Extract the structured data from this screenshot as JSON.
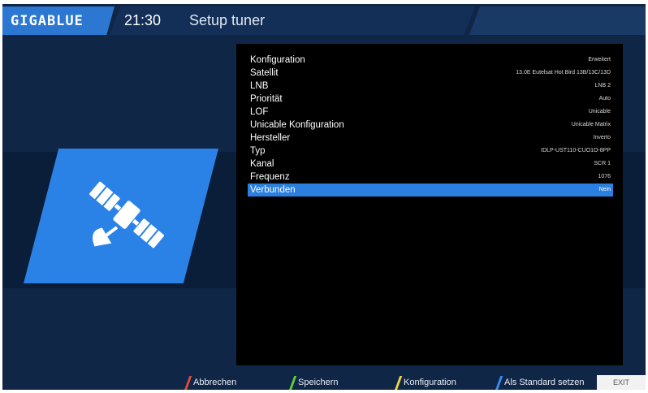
{
  "header": {
    "logo": "GIGABLUE",
    "time": "21:30",
    "title": "Setup tuner"
  },
  "icon": {
    "name": "satellite-icon"
  },
  "settings": [
    {
      "label": "Konfiguration",
      "value": "Erweitert"
    },
    {
      "label": "Satellit",
      "value": "13.0E Eutelsat Hot Bird 13B/13C/13D"
    },
    {
      "label": "LNB",
      "value": "LNB 2"
    },
    {
      "label": "Priorität",
      "value": "Auto"
    },
    {
      "label": "LOF",
      "value": "Unicable"
    },
    {
      "label": "Unicable Konfiguration",
      "value": "Unicable Matrix"
    },
    {
      "label": "Hersteller",
      "value": "Inverto"
    },
    {
      "label": "Typ",
      "value": "IDLP-UST110-CUO1O-8PP"
    },
    {
      "label": "Kanal",
      "value": "SCR 1"
    },
    {
      "label": "Frequenz",
      "value": "1076"
    },
    {
      "label": "Verbunden",
      "value": "Nein"
    }
  ],
  "footer": {
    "red": "Abbrechen",
    "green": "Speichern",
    "yellow": "Konfiguration",
    "blue": "Als Standard setzen",
    "exit": "EXIT"
  },
  "colors": {
    "accent": "#2b7fe0",
    "red": "#e0483d",
    "green": "#5fcf3a",
    "yellow": "#e8d54a",
    "blue": "#3b8cf0"
  }
}
